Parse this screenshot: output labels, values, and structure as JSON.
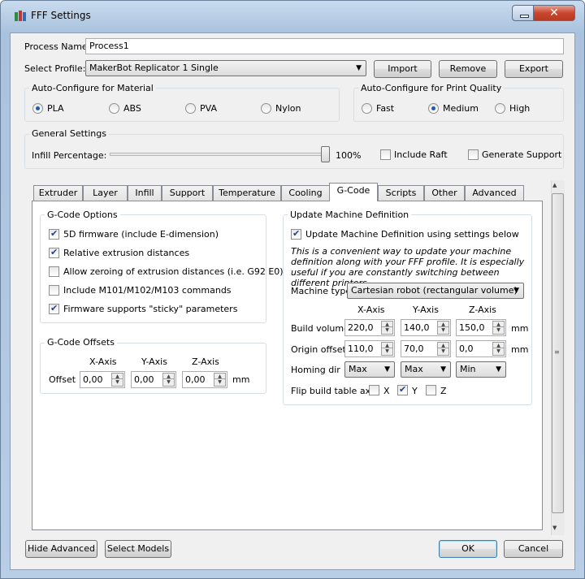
{
  "window": {
    "title": "FFF Settings"
  },
  "process": {
    "label": "Process Name:",
    "value": "Process1"
  },
  "profile": {
    "label": "Select Profile:",
    "value": "MakerBot Replicator 1 Single",
    "import": "Import",
    "remove": "Remove",
    "export": "Export"
  },
  "material": {
    "title": "Auto-Configure for Material",
    "options": [
      "PLA",
      "ABS",
      "PVA",
      "Nylon"
    ],
    "selected": "PLA"
  },
  "quality": {
    "title": "Auto-Configure for Print Quality",
    "options": [
      "Fast",
      "Medium",
      "High"
    ],
    "selected": "Medium"
  },
  "general": {
    "title": "General Settings",
    "infill_label": "Infill Percentage:",
    "infill_value": "100%",
    "infill_level": 1.0,
    "raft": "Include Raft",
    "support": "Generate Support"
  },
  "tabs": [
    "Extruder",
    "Layer",
    "Infill",
    "Support",
    "Temperature",
    "Cooling",
    "G-Code",
    "Scripts",
    "Other",
    "Advanced"
  ],
  "active_tab": "G-Code",
  "gcode_options": {
    "title": "G-Code Options",
    "items": [
      {
        "label": "5D firmware (include E-dimension)",
        "checked": true
      },
      {
        "label": "Relative extrusion distances",
        "checked": true
      },
      {
        "label": "Allow zeroing of extrusion distances (i.e. G92 E0)",
        "checked": false
      },
      {
        "label": "Include M101/M102/M103 commands",
        "checked": false
      },
      {
        "label": "Firmware supports \"sticky\" parameters",
        "checked": true
      }
    ]
  },
  "gcode_offsets": {
    "title": "G-Code Offsets",
    "x_axis": "X-Axis",
    "y_axis": "Y-Axis",
    "z_axis": "Z-Axis",
    "row_label": "Offset",
    "x": "0,00",
    "y": "0,00",
    "z": "0,00",
    "unit": "mm"
  },
  "machine": {
    "title": "Update Machine Definition",
    "update_label": "Update Machine Definition using settings below",
    "note": "This is a convenient way to update your machine definition along with your FFF profile.  It is especially useful if you are constantly switching between different printers.",
    "type_label": "Machine type",
    "type_value": "Cartesian robot (rectangular volume)",
    "x_axis": "X-Axis",
    "y_axis": "Y-Axis",
    "z_axis": "Z-Axis",
    "build_label": "Build volume",
    "build": [
      "220,0",
      "140,0",
      "150,0"
    ],
    "origin_label": "Origin offset",
    "origin": [
      "110,0",
      "70,0",
      "0,0"
    ],
    "unit": "mm",
    "homing_label": "Homing dir",
    "homing": [
      "Max",
      "Max",
      "Min"
    ],
    "flip_label": "Flip build table axis",
    "flip_x": "X",
    "flip_y": "Y",
    "flip_z": "Z"
  },
  "footer": {
    "hide_advanced": "Hide Advanced",
    "select_models": "Select Models",
    "ok": "OK",
    "cancel": "Cancel"
  }
}
